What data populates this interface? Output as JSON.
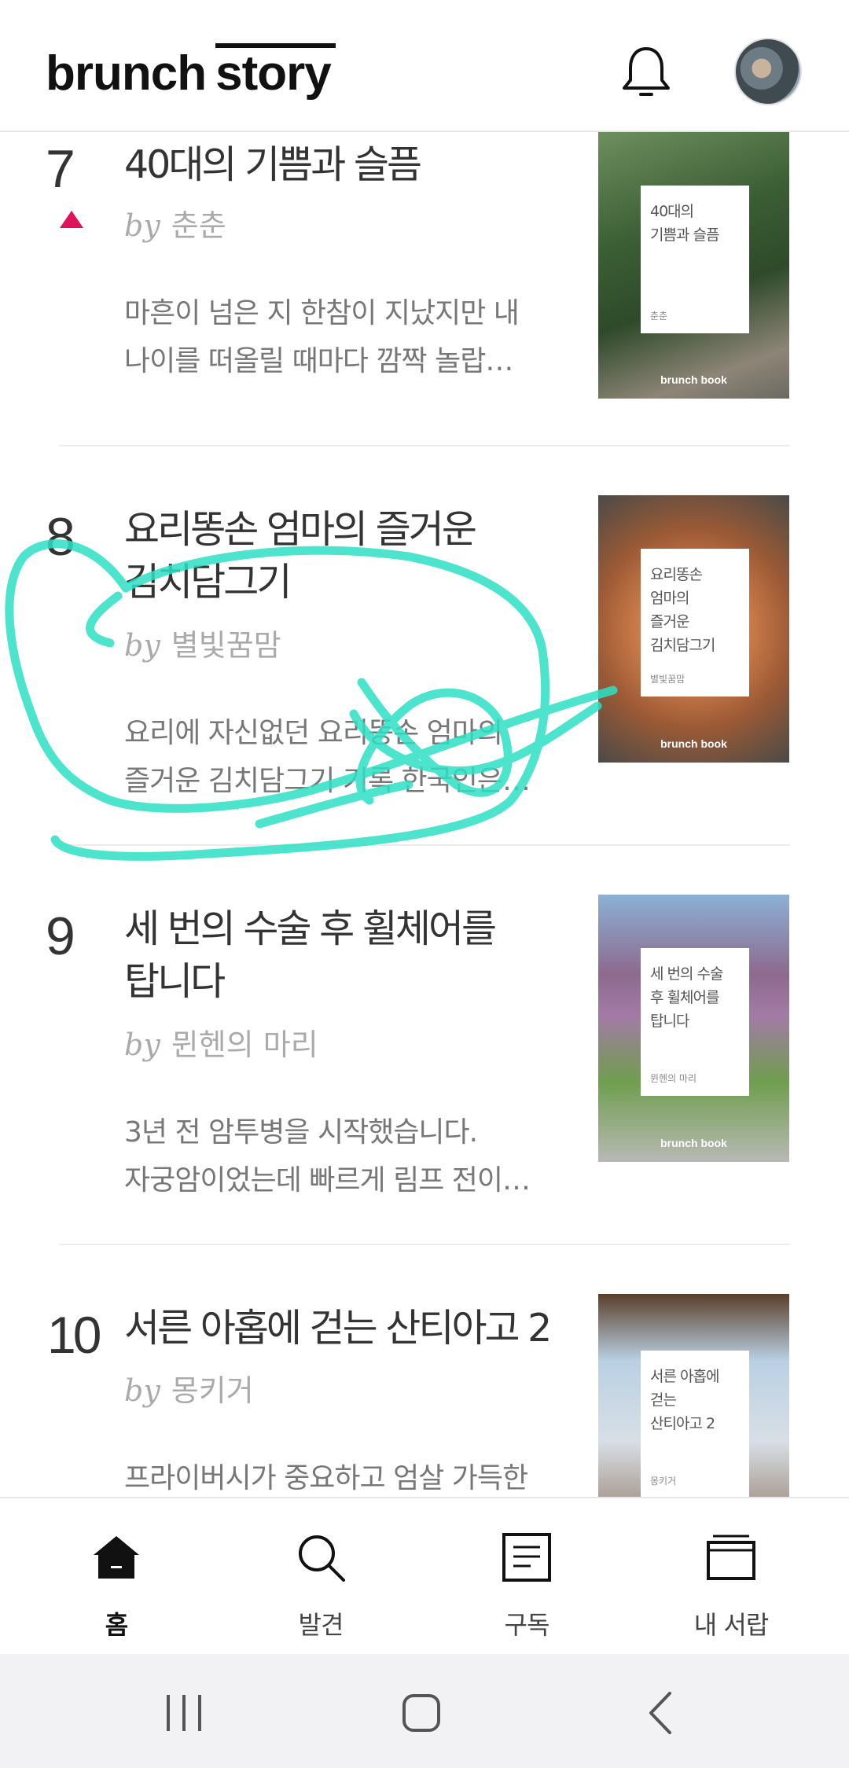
{
  "header": {
    "logo_brunch": "brunch",
    "logo_story": "story",
    "bell_icon": "bell-icon",
    "avatar": "avatar-icon"
  },
  "items": [
    {
      "rank": "7",
      "rank_change": "up",
      "title_lines": [
        "40대의 기쁨과 슬픔"
      ],
      "by": "by",
      "author": "춘춘",
      "desc_lines": [
        "마흔이 넘은 지 한참이 지났지만 내",
        "나이를 떠올릴 때마다 깜짝 놀랍…"
      ],
      "cover": {
        "title_lines": [
          "40대의",
          "기쁨과 슬픔"
        ],
        "author": "춘춘",
        "badge": "brunch book"
      }
    },
    {
      "rank": "8",
      "title_lines": [
        "요리똥손 엄마의 즐거운",
        "김치담그기"
      ],
      "by": "by",
      "author": "별빛꿈맘",
      "desc_lines": [
        "요리에 자신없던 요리똥손 엄마의",
        "즐거운 김치담그기 기록 한국인은…"
      ],
      "cover": {
        "title_lines": [
          "요리똥손",
          "엄마의",
          "즐거운",
          "김치담그기"
        ],
        "author": "별빛꿈맘",
        "badge": "brunch book"
      }
    },
    {
      "rank": "9",
      "title_lines": [
        "세 번의 수술 후 휠체어를",
        "탑니다"
      ],
      "by": "by",
      "author": "뮌헨의 마리",
      "desc_lines": [
        "3년 전 암투병을 시작했습니다.",
        "자궁암이었는데 빠르게 림프 전이…"
      ],
      "cover": {
        "title_lines": [
          "세 번의 수술",
          "후 휠체어를",
          "탑니다"
        ],
        "author": "뮌헨의 마리",
        "badge": "brunch book"
      }
    },
    {
      "rank": "10",
      "title_lines": [
        "서른 아홉에 걷는 산티아고 2"
      ],
      "by": "by",
      "author": "몽키거",
      "desc_lines": [
        "프라이버시가 중요하고 엄살 가득한"
      ],
      "cover": {
        "title_lines": [
          "서른 아홉에",
          "걷는",
          "산티아고 2"
        ],
        "author": "몽키거",
        "badge": ""
      }
    }
  ],
  "nav": [
    {
      "label": "홈",
      "icon": "home-icon",
      "active": true
    },
    {
      "label": "발견",
      "icon": "search-icon",
      "active": false
    },
    {
      "label": "구독",
      "icon": "document-icon",
      "active": false
    },
    {
      "label": "내 서랍",
      "icon": "drawer-icon",
      "active": false
    }
  ],
  "system_nav": [
    "recent-apps-icon",
    "home-button-icon",
    "back-icon"
  ],
  "colors": {
    "rank_up": "#e0125c",
    "highlight": "#2de0c4"
  }
}
